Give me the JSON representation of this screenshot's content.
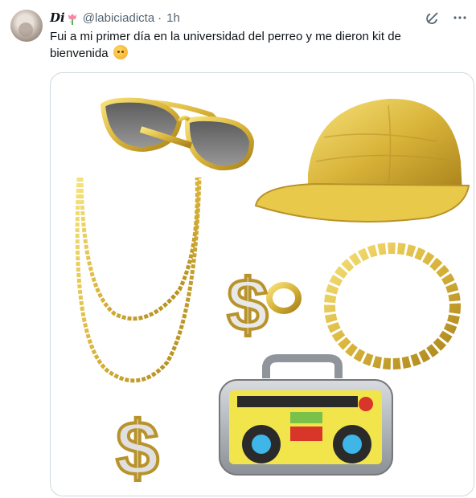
{
  "author": {
    "display_name": "Di",
    "handle": "@labiciadicta",
    "separator": "·",
    "time": "1h"
  },
  "tweet": {
    "text": "Fui a mi primer día en la universidad del perreo y me dieron kit de bienvenida"
  },
  "icons": {
    "emoji": "hugging-face-emoji",
    "tulip": "tulip-emoji",
    "grok": "grok-icon",
    "more": "more-options-icon"
  },
  "image": {
    "items": [
      "gold aviator sunglasses",
      "gold snakeskin cap",
      "gold dollar chain necklace",
      "gold dollar ring",
      "gold chain bracelet",
      "inflatable boombox"
    ]
  },
  "colors": {
    "gold": "#d9b83a",
    "gold_dark": "#a8821a",
    "muted": "#536471",
    "border": "#cfd9de"
  }
}
